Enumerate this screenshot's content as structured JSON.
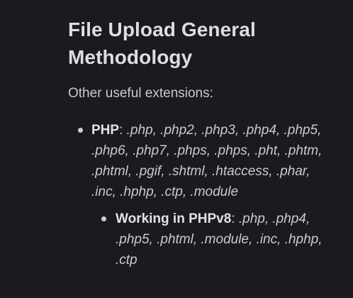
{
  "heading": "File Upload General Methodology",
  "intro": "Other useful extensions:",
  "list": {
    "php": {
      "label": "PHP",
      "separator": ": ",
      "extensions": ".php, .php2, .php3, .php4, .php5, .php6, .php7, .phps, .phps, .pht, .phtm, .phtml, .pgif, .shtml, .htaccess, .phar, .inc, .hphp, .ctp, .module"
    },
    "phpv8": {
      "label": "Working in PHPv8",
      "separator": ": ",
      "extensions": ".php, .php4, .php5, .phtml, .module, .inc, .hphp, .ctp"
    }
  }
}
